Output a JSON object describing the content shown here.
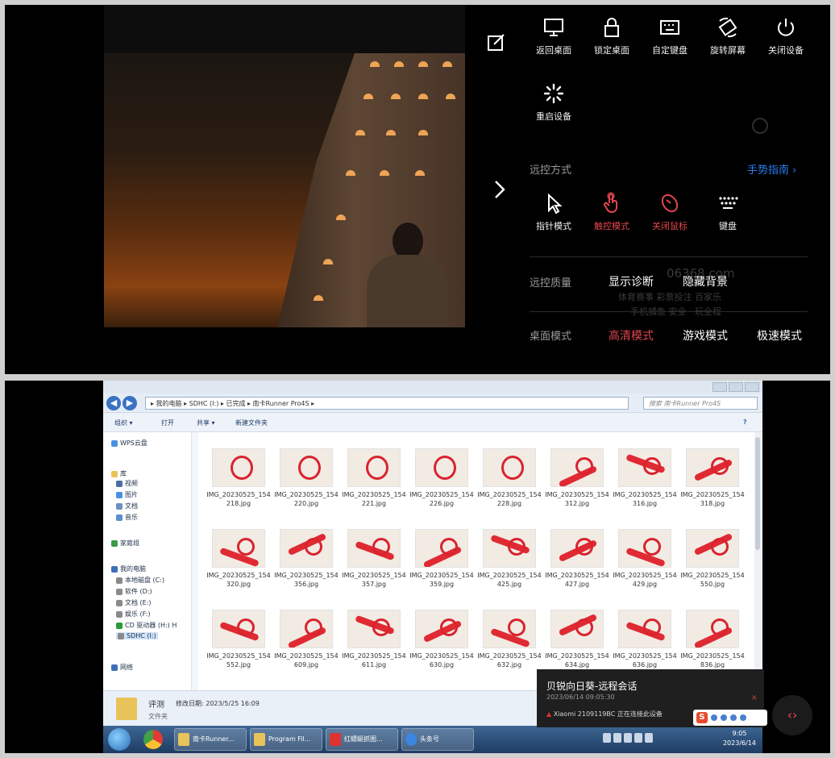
{
  "overlay": {
    "top_buttons": [
      "返回桌面",
      "锁定桌面",
      "自定键盘",
      "旋转屏幕",
      "关闭设备"
    ],
    "restart": "重启设备",
    "control_label": "远控方式",
    "gesture_guide": "手势指南 ›",
    "control_modes": [
      "指针模式",
      "触控模式",
      "关闭鼠标",
      "键盘"
    ],
    "quality_label": "远控质量",
    "quality_options": [
      "显示诊断",
      "隐藏背景"
    ],
    "desktop_label": "桌面模式",
    "desktop_options": [
      "高清模式",
      "游戏模式",
      "极速模式"
    ],
    "ghost_text": [
      "06368.com",
      "体育赛事 彩票投注 百家乐",
      "手机捕鱼 安全 · 玩全程"
    ],
    "accent": "#e3464e",
    "link": "#2d7ef0"
  },
  "explorer": {
    "address": "▸ 我的电脑 ▸ SDHC (I:) ▸ 已完成 ▸ 南卡Runner Pro4S ▸",
    "search_placeholder": "搜索 南卡Runner Pro4S",
    "toolbar": [
      "组织 ▾",
      "打开",
      "共享 ▾",
      "新建文件夹"
    ],
    "sidebar": [
      "WPS云盘",
      "库",
      "视频",
      "图片",
      "文档",
      "音乐",
      "家庭组",
      "我的电脑",
      "本地磁盘 (C:)",
      "软件 (D:)",
      "文档 (E:)",
      "娱乐 (F:)",
      "CD 驱动器 (H:) H",
      "SDHC (I:)",
      "网络"
    ],
    "files": [
      "IMG_20230525_154218.jpg",
      "IMG_20230525_154220.jpg",
      "IMG_20230525_154221.jpg",
      "IMG_20230525_154226.jpg",
      "IMG_20230525_154228.jpg",
      "IMG_20230525_154312.jpg",
      "IMG_20230525_154316.jpg",
      "IMG_20230525_154318.jpg",
      "IMG_20230525_154320.jpg",
      "IMG_20230525_154356.jpg",
      "IMG_20230525_154357.jpg",
      "IMG_20230525_154359.jpg",
      "IMG_20230525_154425.jpg",
      "IMG_20230525_154427.jpg",
      "IMG_20230525_154429.jpg",
      "IMG_20230525_154550.jpg",
      "IMG_20230525_154552.jpg",
      "IMG_20230525_154609.jpg",
      "IMG_20230525_154611.jpg",
      "IMG_20230525_154630.jpg",
      "IMG_20230525_154632.jpg",
      "IMG_20230525_154634.jpg",
      "IMG_20230525_154636.jpg",
      "IMG_20230525_154836.jpg"
    ],
    "details_name": "评测",
    "details_date": "修改日期: 2023/5/25 16:09",
    "details_type": "文件夹",
    "taskbar_items": [
      "南卡Runner...",
      "Program Fil...",
      "红蜻蜓抓图...",
      "头条号"
    ],
    "clock_time": "9:05",
    "clock_date": "2023/6/14"
  },
  "notification": {
    "title": "贝锐向日葵-远程会话",
    "time": "2023/06/14 09:05:30",
    "device": "Xiaomi 2109119BC   正在连接此设备",
    "close": "×"
  },
  "remote_button": "‹›"
}
